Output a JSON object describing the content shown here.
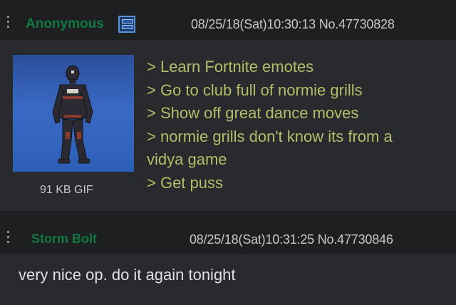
{
  "post1": {
    "name": "Anonymous",
    "meta": "08/25/18(Sat)10:30:13 No.47730828",
    "file_info": "91 KB GIF",
    "lines": [
      "> Learn Fortnite emotes",
      "> Go to club full of normie grills",
      "> Show off great dance moves",
      "> normie grills don't know its from a",
      "vidya game",
      "> Get puss"
    ]
  },
  "post2": {
    "name": "Storm Bolt",
    "meta": "08/25/18(Sat)10:31:25 No.47730846",
    "comment": "very nice op. do it again tonight"
  },
  "colors": {
    "background": "#1d1f21",
    "post_background": "#282a2e",
    "name": "#117743",
    "greentext": "#b5bd68",
    "text": "#c5c8c6"
  },
  "icons": {
    "post_menu": "vertical-dots-icon",
    "flag": "floppy-disk-flag-icon"
  }
}
